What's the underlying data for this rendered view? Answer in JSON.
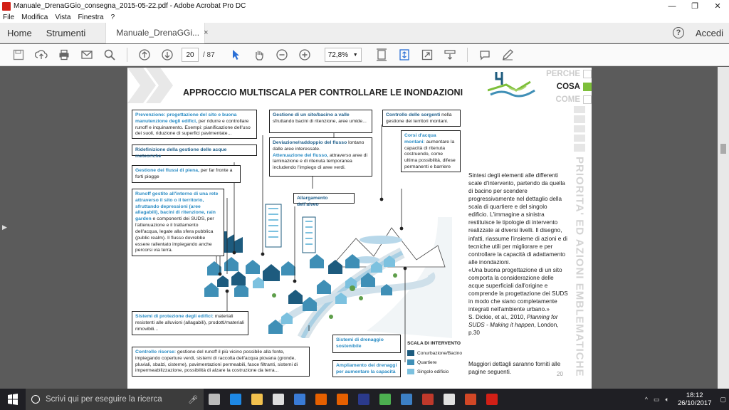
{
  "window": {
    "title": "Manuale_DrenaGGio_consegna_2015-05-22.pdf - Adobe Acrobat Pro DC",
    "minimize": "—",
    "maximize": "❐",
    "close": "✕"
  },
  "menu": [
    "File",
    "Modifica",
    "Vista",
    "Finestra",
    "?"
  ],
  "tabs": {
    "home": "Home",
    "tools": "Strumenti",
    "document": "Manuale_DrenaGGi...",
    "close": "×",
    "help": "?",
    "signin": "Accedi"
  },
  "toolbar": {
    "page_current": "20",
    "page_total": "/ 87",
    "zoom": "72,8%"
  },
  "page": {
    "title": "APPROCCIO MULTISCALA PER CONTROLLARE LE INONDAZIONI",
    "nav": [
      "PERCHE",
      "COSA",
      "COME"
    ],
    "side_vertical": "PRIORITA' ED AZIONI EMBLEMATICHE",
    "boxes": {
      "prevenzione_hl": "Prevenzione: progettazione del sito e buona manutenzione degli edifici,",
      "prevenzione_rest": " per ridurre e controllare runoff e inquinamento. Esempi: pianificazione dell'uso dei suoli, riduzione di superfici pavimentate...",
      "ridefinizione": "Ridefinizione della gestione delle acque meteoriche",
      "flussi_hl": "Gestione dei flussi di piena,",
      "flussi_rest": " per far fronte a forti piogge",
      "runoff_hl": "Runoff gestito all'interno di una rete attraverso il sito o il territorio, sfruttando depressioni (aree allagabili), bacini di ritenzione, rain garden",
      "runoff_rest": " e componenti dei SUDS, per l'attenuazione e il trattamento dell'acqua, legate alla sfera pubblica (public realm). Il flusso dovrebbe essere rallentato impiegando anche percorsi via terra.",
      "sito_hl": "Gestione di un sito/bacino a valle",
      "sito_rest": " sfruttando bacini di ritenzione, aree umide...",
      "deviazione_hl": "Deviazione/raddoppio del flusso",
      "deviazione_rest1": " lontano dalle aree interessate.",
      "attenuazione_hl": "Attenuazione  del flusso,",
      "attenuazione_rest": " attraverso aree di laminazione e di ritenuta temporanea includendo l'impiego di aree verdi.",
      "sorgenti_hl": "Controllo delle sorgenti",
      "sorgenti_rest": " nella gestione dei territori montani.",
      "montani_hl": "Corsi d'acqua montani:",
      "montani_rest": " aumentare la capacità di ritenuta costruendo, come ultima possibilità, difese permanenti e barriere",
      "alveo": "Allargamento dell'alveo",
      "protezione_hl": "Sistemi di protezione degli edifici:",
      "protezione_rest": " materiali resistenti alle alluvioni (allagabili), prodotti/materiali rimovibili...",
      "risorse_hl": "Controllo risorse:",
      "risorse_rest": " gestione del runoff il più vicino possibile alla fonte, impiegando coperture verdi,  sistemi di raccolta dell'acqua piovana (gronde, pluviali, sbalzi, cisterne), pavimentazioni permeabili, fasce filtranti,  sistemi di impermeabilizzazione,  possibilità di alzare la costruzione da terra...",
      "drenaggio": "Sistemi di drenaggio sostenibile",
      "ampliamento": "Ampliamento dei drenaggi per aumentare la capacità"
    },
    "legend": {
      "title": "SCALA DI INTERVENTO",
      "items": [
        {
          "label": "Conurbazione/Bacino",
          "color": "#1d5b7e"
        },
        {
          "label": "Quartiere",
          "color": "#3f8fb6"
        },
        {
          "label": "Singolo edificio",
          "color": "#7cc1df"
        }
      ]
    },
    "side_text": "Sintesi degli elementi alle differenti scale d'intervento, partendo da quella di bacino per scendere progressivamente nel dettaglio della scala di quartiere e del singolo edificio. L'immagine a sinistra restituisce le tipologie di intervento realizzate ai diversi livelli. Il disegno, infatti, riassume l'insieme di azioni e di tecniche utili per migliorare e per controllare la capacità di adattamento alle inondazioni.",
    "quote": "«Una buona progettazione di un sito comporta la considerazione delle acque superficiali dall'origine e comprende la progettazione dei SUDS in modo che siano completamente integrati nell'ambiente urbano.»",
    "citation_pre": "S. Dickie, et al., 2010, ",
    "citation_italic": "Planning for SUDS - Making it happen",
    "citation_post": ", London, p.30",
    "more": "Maggiori dettagli saranno forniti alle pagine seguenti.",
    "page_number": "20"
  },
  "taskbar": {
    "search_placeholder": "Scrivi qui per eseguire la ricerca",
    "time": "18:12",
    "date": "26/10/2017",
    "apps": [
      {
        "name": "task-view",
        "color": "#bbbbbb"
      },
      {
        "name": "edge",
        "color": "#1e88e5"
      },
      {
        "name": "file-explorer",
        "color": "#f2c14e"
      },
      {
        "name": "store",
        "color": "#dddddd"
      },
      {
        "name": "mail",
        "color": "#3a7bd5"
      },
      {
        "name": "firefox",
        "color": "#e66000"
      },
      {
        "name": "firefox2",
        "color": "#e66000"
      },
      {
        "name": "op",
        "color": "#2b3a8c"
      },
      {
        "name": "chrome",
        "color": "#4caf50"
      },
      {
        "name": "app-blue",
        "color": "#3c7fc4"
      },
      {
        "name": "app-red",
        "color": "#c0392b"
      },
      {
        "name": "app-doc",
        "color": "#e0e0e0"
      },
      {
        "name": "powerpoint",
        "color": "#d24726"
      },
      {
        "name": "acrobat",
        "color": "#d21f16"
      }
    ]
  }
}
